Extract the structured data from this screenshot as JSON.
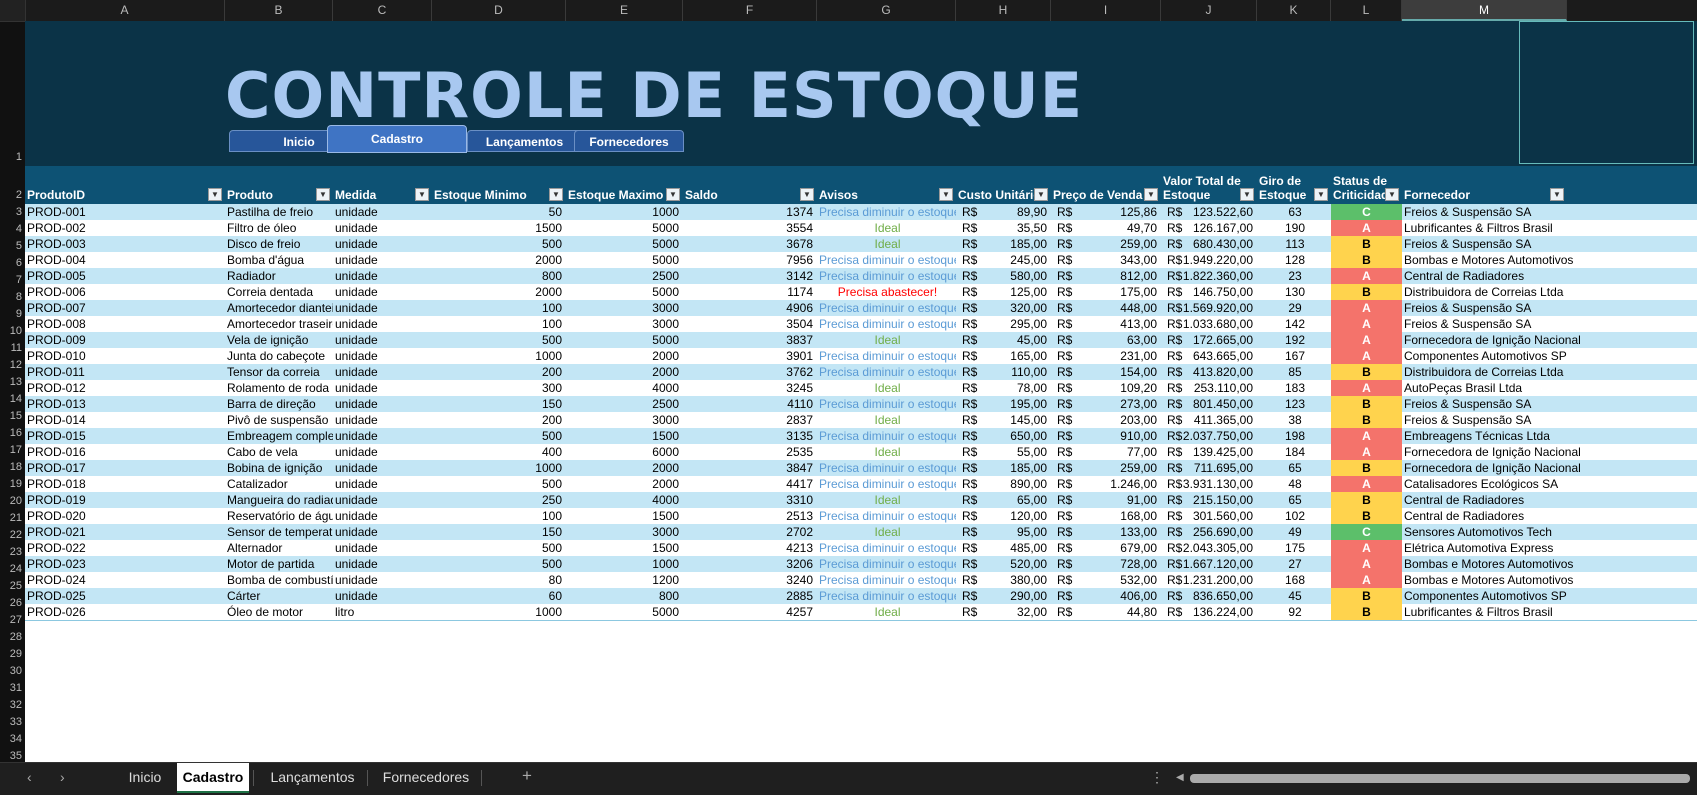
{
  "columns": [
    "A",
    "B",
    "C",
    "D",
    "E",
    "F",
    "G",
    "H",
    "I",
    "J",
    "K",
    "L",
    "M"
  ],
  "title": "CONTROLE DE ESTOQUE",
  "nav": [
    "Inicio",
    "Cadastro",
    "Lançamentos",
    "Fornecedores"
  ],
  "headers": {
    "produtoid": "ProdutoID",
    "produto": "Produto",
    "medida": "Medida",
    "estmin": "Estoque Minimo",
    "estmax": "Estoque Maximo",
    "saldo": "Saldo",
    "avisos": "Avisos",
    "custo": "Custo Unitário",
    "preco": "Preço de Venda",
    "valor1": "Valor Total de",
    "valor2": "Estoque",
    "giro1": "Giro de",
    "giro2": "Estoque",
    "status1": "Status de",
    "status2": "Criticidade",
    "fornecedor": "Fornecedor"
  },
  "currency": "R$",
  "rows": [
    {
      "id": "PROD-001",
      "produto": "Pastilha de freio",
      "medida": "unidade",
      "min": "50",
      "max": "1000",
      "saldo": "1374",
      "aviso": "Precisa diminuir o estoque",
      "custo": "89,90",
      "preco": "125,86",
      "valor": "123.522,60",
      "giro": "63",
      "status": "C",
      "fornecedor": "Freios & Suspensão SA"
    },
    {
      "id": "PROD-002",
      "produto": "Filtro de óleo",
      "medida": "unidade",
      "min": "1500",
      "max": "5000",
      "saldo": "3554",
      "aviso": "Ideal",
      "custo": "35,50",
      "preco": "49,70",
      "valor": "126.167,00",
      "giro": "190",
      "status": "A",
      "fornecedor": "Lubrificantes & Filtros Brasil"
    },
    {
      "id": "PROD-003",
      "produto": "Disco de freio",
      "medida": "unidade",
      "min": "500",
      "max": "5000",
      "saldo": "3678",
      "aviso": "Ideal",
      "custo": "185,00",
      "preco": "259,00",
      "valor": "680.430,00",
      "giro": "113",
      "status": "B",
      "fornecedor": "Freios & Suspensão SA"
    },
    {
      "id": "PROD-004",
      "produto": "Bomba d'água",
      "medida": "unidade",
      "min": "2000",
      "max": "5000",
      "saldo": "7956",
      "aviso": "Precisa diminuir o estoque",
      "custo": "245,00",
      "preco": "343,00",
      "valor": "1.949.220,00",
      "giro": "128",
      "status": "B",
      "fornecedor": "Bombas e Motores Automotivos"
    },
    {
      "id": "PROD-005",
      "produto": "Radiador",
      "medida": "unidade",
      "min": "800",
      "max": "2500",
      "saldo": "3142",
      "aviso": "Precisa diminuir o estoque",
      "custo": "580,00",
      "preco": "812,00",
      "valor": "1.822.360,00",
      "giro": "23",
      "status": "A",
      "fornecedor": "Central de Radiadores"
    },
    {
      "id": "PROD-006",
      "produto": "Correia dentada",
      "medida": "unidade",
      "min": "2000",
      "max": "5000",
      "saldo": "1174",
      "aviso": "Precisa abastecer!",
      "custo": "125,00",
      "preco": "175,00",
      "valor": "146.750,00",
      "giro": "130",
      "status": "B",
      "fornecedor": "Distribuidora de Correias Ltda"
    },
    {
      "id": "PROD-007",
      "produto": "Amortecedor dianteiro",
      "medida": "unidade",
      "min": "100",
      "max": "3000",
      "saldo": "4906",
      "aviso": "Precisa diminuir o estoque",
      "custo": "320,00",
      "preco": "448,00",
      "valor": "1.569.920,00",
      "giro": "29",
      "status": "A",
      "fornecedor": "Freios & Suspensão SA"
    },
    {
      "id": "PROD-008",
      "produto": "Amortecedor traseiro",
      "medida": "unidade",
      "min": "100",
      "max": "3000",
      "saldo": "3504",
      "aviso": "Precisa diminuir o estoque",
      "custo": "295,00",
      "preco": "413,00",
      "valor": "1.033.680,00",
      "giro": "142",
      "status": "A",
      "fornecedor": "Freios & Suspensão SA"
    },
    {
      "id": "PROD-009",
      "produto": "Vela de ignição",
      "medida": "unidade",
      "min": "500",
      "max": "5000",
      "saldo": "3837",
      "aviso": "Ideal",
      "custo": "45,00",
      "preco": "63,00",
      "valor": "172.665,00",
      "giro": "192",
      "status": "A",
      "fornecedor": "Fornecedora de Ignição Nacional"
    },
    {
      "id": "PROD-010",
      "produto": "Junta do cabeçote",
      "medida": "unidade",
      "min": "1000",
      "max": "2000",
      "saldo": "3901",
      "aviso": "Precisa diminuir o estoque",
      "custo": "165,00",
      "preco": "231,00",
      "valor": "643.665,00",
      "giro": "167",
      "status": "A",
      "fornecedor": "Componentes Automotivos SP"
    },
    {
      "id": "PROD-011",
      "produto": "Tensor da correia",
      "medida": "unidade",
      "min": "200",
      "max": "2000",
      "saldo": "3762",
      "aviso": "Precisa diminuir o estoque",
      "custo": "110,00",
      "preco": "154,00",
      "valor": "413.820,00",
      "giro": "85",
      "status": "B",
      "fornecedor": "Distribuidora de Correias Ltda"
    },
    {
      "id": "PROD-012",
      "produto": "Rolamento de roda",
      "medida": "unidade",
      "min": "300",
      "max": "4000",
      "saldo": "3245",
      "aviso": "Ideal",
      "custo": "78,00",
      "preco": "109,20",
      "valor": "253.110,00",
      "giro": "183",
      "status": "A",
      "fornecedor": "AutoPeças Brasil Ltda"
    },
    {
      "id": "PROD-013",
      "produto": "Barra de direção",
      "medida": "unidade",
      "min": "150",
      "max": "2500",
      "saldo": "4110",
      "aviso": "Precisa diminuir o estoque",
      "custo": "195,00",
      "preco": "273,00",
      "valor": "801.450,00",
      "giro": "123",
      "status": "B",
      "fornecedor": "Freios & Suspensão SA"
    },
    {
      "id": "PROD-014",
      "produto": "Pivô de suspensão",
      "medida": "unidade",
      "min": "200",
      "max": "3000",
      "saldo": "2837",
      "aviso": "Ideal",
      "custo": "145,00",
      "preco": "203,00",
      "valor": "411.365,00",
      "giro": "38",
      "status": "B",
      "fornecedor": "Freios & Suspensão SA"
    },
    {
      "id": "PROD-015",
      "produto": "Embreagem completa",
      "medida": "unidade",
      "min": "500",
      "max": "1500",
      "saldo": "3135",
      "aviso": "Precisa diminuir o estoque",
      "custo": "650,00",
      "preco": "910,00",
      "valor": "2.037.750,00",
      "giro": "198",
      "status": "A",
      "fornecedor": "Embreagens Técnicas Ltda"
    },
    {
      "id": "PROD-016",
      "produto": "Cabo de vela",
      "medida": "unidade",
      "min": "400",
      "max": "6000",
      "saldo": "2535",
      "aviso": "Ideal",
      "custo": "55,00",
      "preco": "77,00",
      "valor": "139.425,00",
      "giro": "184",
      "status": "A",
      "fornecedor": "Fornecedora de Ignição Nacional"
    },
    {
      "id": "PROD-017",
      "produto": "Bobina de ignição",
      "medida": "unidade",
      "min": "1000",
      "max": "2000",
      "saldo": "3847",
      "aviso": "Precisa diminuir o estoque",
      "custo": "185,00",
      "preco": "259,00",
      "valor": "711.695,00",
      "giro": "65",
      "status": "B",
      "fornecedor": "Fornecedora de Ignição Nacional"
    },
    {
      "id": "PROD-018",
      "produto": "Catalizador",
      "medida": "unidade",
      "min": "500",
      "max": "2000",
      "saldo": "4417",
      "aviso": "Precisa diminuir o estoque",
      "custo": "890,00",
      "preco": "1.246,00",
      "valor": "3.931.130,00",
      "giro": "48",
      "status": "A",
      "fornecedor": "Catalisadores Ecológicos SA"
    },
    {
      "id": "PROD-019",
      "produto": "Mangueira do radiador",
      "medida": "unidade",
      "min": "250",
      "max": "4000",
      "saldo": "3310",
      "aviso": "Ideal",
      "custo": "65,00",
      "preco": "91,00",
      "valor": "215.150,00",
      "giro": "65",
      "status": "B",
      "fornecedor": "Central de Radiadores"
    },
    {
      "id": "PROD-020",
      "produto": "Reservatório de água",
      "medida": "unidade",
      "min": "100",
      "max": "1500",
      "saldo": "2513",
      "aviso": "Precisa diminuir o estoque",
      "custo": "120,00",
      "preco": "168,00",
      "valor": "301.560,00",
      "giro": "102",
      "status": "B",
      "fornecedor": "Central de Radiadores"
    },
    {
      "id": "PROD-021",
      "produto": "Sensor de temperatura",
      "medida": "unidade",
      "min": "150",
      "max": "3000",
      "saldo": "2702",
      "aviso": "Ideal",
      "custo": "95,00",
      "preco": "133,00",
      "valor": "256.690,00",
      "giro": "49",
      "status": "C",
      "fornecedor": "Sensores Automotivos Tech"
    },
    {
      "id": "PROD-022",
      "produto": "Alternador",
      "medida": "unidade",
      "min": "500",
      "max": "1500",
      "saldo": "4213",
      "aviso": "Precisa diminuir o estoque",
      "custo": "485,00",
      "preco": "679,00",
      "valor": "2.043.305,00",
      "giro": "175",
      "status": "A",
      "fornecedor": "Elétrica Automotiva Express"
    },
    {
      "id": "PROD-023",
      "produto": "Motor de partida",
      "medida": "unidade",
      "min": "500",
      "max": "1000",
      "saldo": "3206",
      "aviso": "Precisa diminuir o estoque",
      "custo": "520,00",
      "preco": "728,00",
      "valor": "1.667.120,00",
      "giro": "27",
      "status": "A",
      "fornecedor": "Bombas e Motores Automotivos"
    },
    {
      "id": "PROD-024",
      "produto": "Bomba de combustível",
      "medida": "unidade",
      "min": "80",
      "max": "1200",
      "saldo": "3240",
      "aviso": "Precisa diminuir o estoque",
      "custo": "380,00",
      "preco": "532,00",
      "valor": "1.231.200,00",
      "giro": "168",
      "status": "A",
      "fornecedor": "Bombas e Motores Automotivos"
    },
    {
      "id": "PROD-025",
      "produto": "Cárter",
      "medida": "unidade",
      "min": "60",
      "max": "800",
      "saldo": "2885",
      "aviso": "Precisa diminuir o estoque",
      "custo": "290,00",
      "preco": "406,00",
      "valor": "836.650,00",
      "giro": "45",
      "status": "B",
      "fornecedor": "Componentes Automotivos SP"
    },
    {
      "id": "PROD-026",
      "produto": "Óleo de motor",
      "medida": "litro",
      "min": "1000",
      "max": "5000",
      "saldo": "4257",
      "aviso": "Ideal",
      "custo": "32,00",
      "preco": "44,80",
      "valor": "136.224,00",
      "giro": "92",
      "status": "B",
      "fornecedor": "Lubrificantes & Filtros Brasil"
    }
  ],
  "row_numbers": [
    "1",
    "2",
    "3",
    "4",
    "5",
    "6",
    "7",
    "8",
    "9",
    "10",
    "11",
    "12",
    "13",
    "14",
    "15",
    "16",
    "17",
    "18",
    "19",
    "20",
    "21",
    "22",
    "23",
    "24",
    "25",
    "26",
    "27",
    "28",
    "29",
    "30",
    "31",
    "32",
    "33",
    "34",
    "35"
  ],
  "sheet_tabs": [
    "Inicio",
    "Cadastro",
    "Lançamentos",
    "Fornecedores"
  ],
  "active_tab": "Cadastro",
  "colors": {
    "header": "#0d5274",
    "banner": "#0b3347",
    "status_A": "#f4736b",
    "status_B": "#ffd34d",
    "status_C": "#5cbf6a"
  }
}
